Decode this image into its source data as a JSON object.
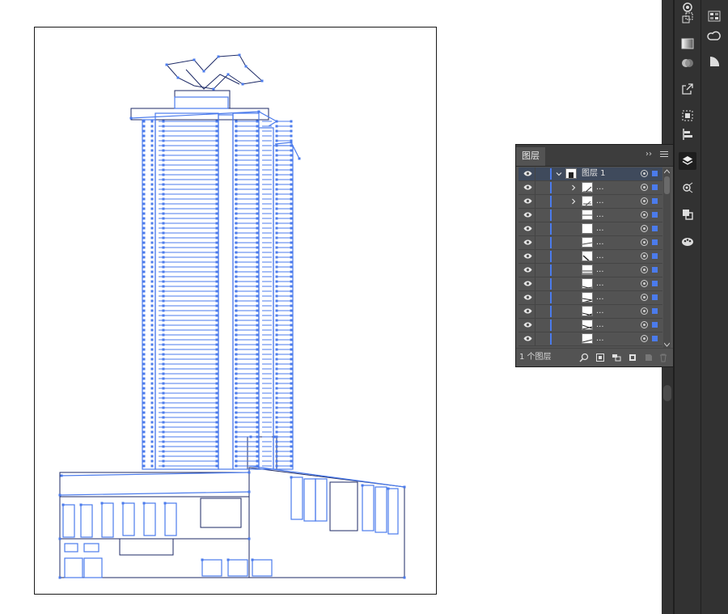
{
  "layers_panel": {
    "tab_label": "图层",
    "collapse_label": "››",
    "rows": [
      {
        "name": "图层 1",
        "expanded": true,
        "visible": true,
        "selected": true
      },
      {
        "name": "...",
        "has_children": true,
        "visible": true
      },
      {
        "name": "...",
        "has_children": true,
        "visible": true
      },
      {
        "name": "...",
        "visible": true
      },
      {
        "name": "...",
        "visible": true
      },
      {
        "name": "...",
        "visible": true
      },
      {
        "name": "...",
        "visible": true
      },
      {
        "name": "...",
        "visible": true
      },
      {
        "name": "...",
        "visible": true
      },
      {
        "name": "...",
        "visible": true
      },
      {
        "name": "...",
        "visible": true
      },
      {
        "name": "...",
        "visible": true
      },
      {
        "name": "...",
        "visible": true
      }
    ],
    "footer": {
      "layer_count": "1 个图层",
      "icons": [
        "search-icon",
        "collect-for-export-icon",
        "make-clipping-mask-icon",
        "new-sublayer-icon",
        "new-layer-icon",
        "delete-layer-icon"
      ]
    }
  },
  "dock_tools": [
    "appearance-icon",
    "transform-icon",
    "gradient-icon",
    "transparency-icon",
    "export-icon",
    "align-icon",
    "layers-icon",
    "links-icon",
    "pathfinder-icon",
    "color-themes-icon",
    "swatches-icon",
    "cc-libraries-icon",
    "symbols-icon"
  ],
  "colors": {
    "selection": "#4b7bec",
    "panel_bg": "#535353",
    "dock_bg": "#323232"
  }
}
